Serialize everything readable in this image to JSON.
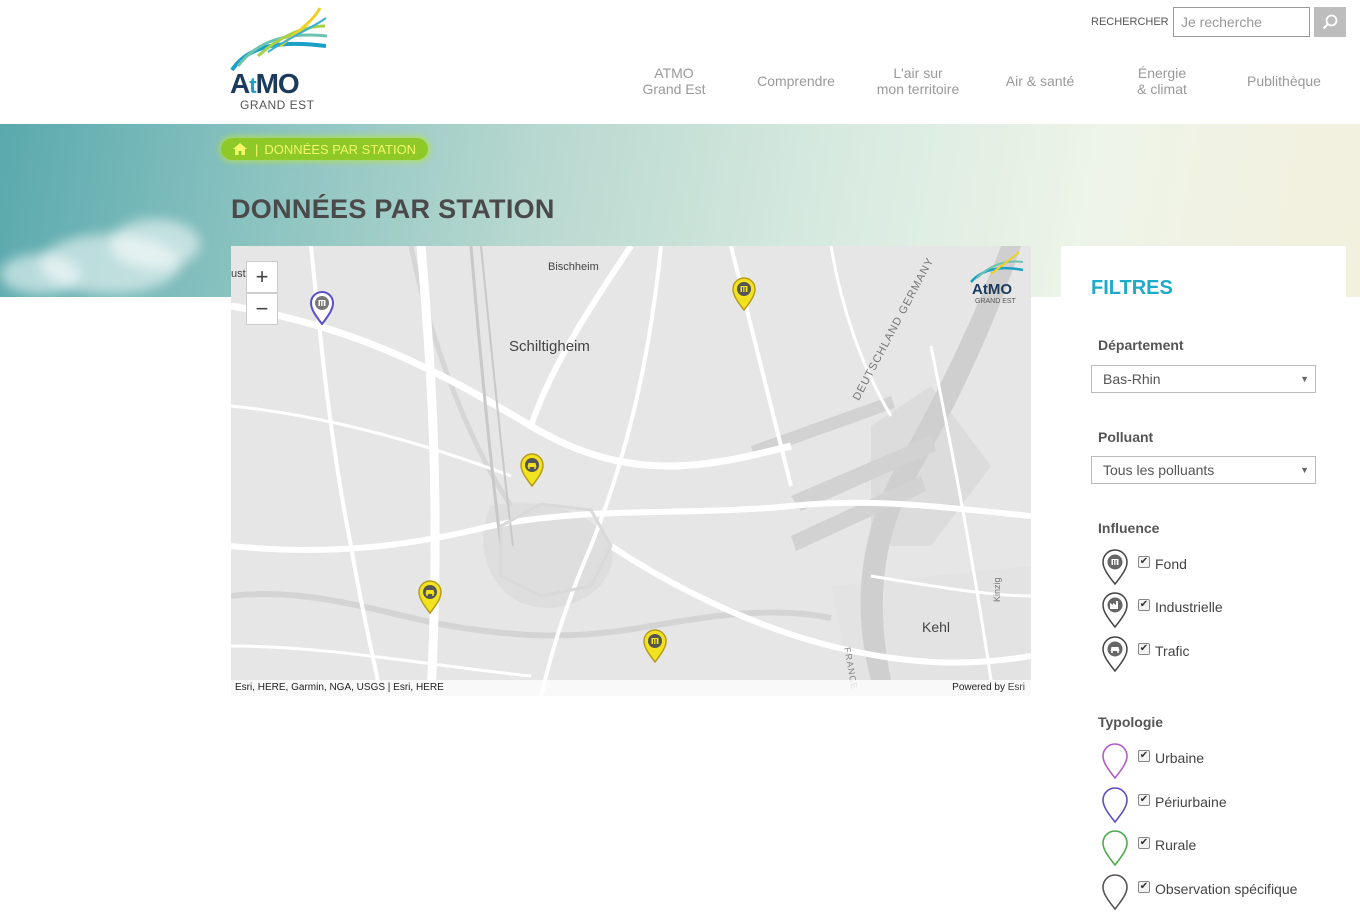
{
  "header": {
    "logo_word_a": "A",
    "logo_word_t": "t",
    "logo_word_mo": "MO",
    "logo_sub": "GRAND EST",
    "search_label": "RECHERCHER",
    "search_placeholder": "Je recherche",
    "nav": [
      {
        "line1": "ATMO",
        "line2": "Grand Est"
      },
      {
        "line1": "Comprendre",
        "line2": ""
      },
      {
        "line1": "L'air sur",
        "line2": "mon territoire"
      },
      {
        "line1": "Air & santé",
        "line2": ""
      },
      {
        "line1": "Énergie",
        "line2": "& climat"
      },
      {
        "line1": "Publithèque",
        "line2": ""
      }
    ]
  },
  "breadcrumb": {
    "current": "DONNÉES PAR STATION"
  },
  "page": {
    "title": "DONNÉES PAR STATION"
  },
  "map": {
    "zoom_in": "+",
    "zoom_out": "−",
    "labels": {
      "bischheim": "Bischheim",
      "schiltigheim": "Schiltigheim",
      "kehl": "Kehl",
      "deutschland": "DEUTSCHLAND GERMANY",
      "kinzig": "Kinzig",
      "france": "FRANCE",
      "cut": "ust"
    },
    "logo_word": "AtMO",
    "logo_sub": "GRAND EST",
    "attribution": "Esri, HERE, Garmin, NGA, USGS | Esri, HERE",
    "powered_by": "Powered by",
    "powered_brand": "Esri"
  },
  "filters": {
    "title": "FILTRES",
    "departement": {
      "label": "Département",
      "selected": "Bas-Rhin"
    },
    "polluant": {
      "label": "Polluant",
      "selected": "Tous les polluants"
    },
    "influence": {
      "label": "Influence",
      "items": [
        {
          "label": "Fond",
          "checked": true
        },
        {
          "label": "Industrielle",
          "checked": true
        },
        {
          "label": "Trafic",
          "checked": true
        }
      ]
    },
    "typologie": {
      "label": "Typologie",
      "items": [
        {
          "label": "Urbaine",
          "checked": true,
          "color": "#b05cc8"
        },
        {
          "label": "Périurbaine",
          "checked": true,
          "color": "#5a4fc4"
        },
        {
          "label": "Rurale",
          "checked": true,
          "color": "#4caa4c"
        },
        {
          "label": "Observation spécifique",
          "checked": true,
          "color": "#555555"
        }
      ]
    }
  },
  "colors": {
    "accent": "#1eaac9",
    "breadcrumb_bg": "#8ec928",
    "breadcrumb_text": "#f4f76a",
    "pin_yellow": "#f1e320"
  },
  "icons": [
    "search-icon",
    "home-icon",
    "building-icon",
    "factory-icon",
    "car-icon",
    "map-pin-icon"
  ]
}
